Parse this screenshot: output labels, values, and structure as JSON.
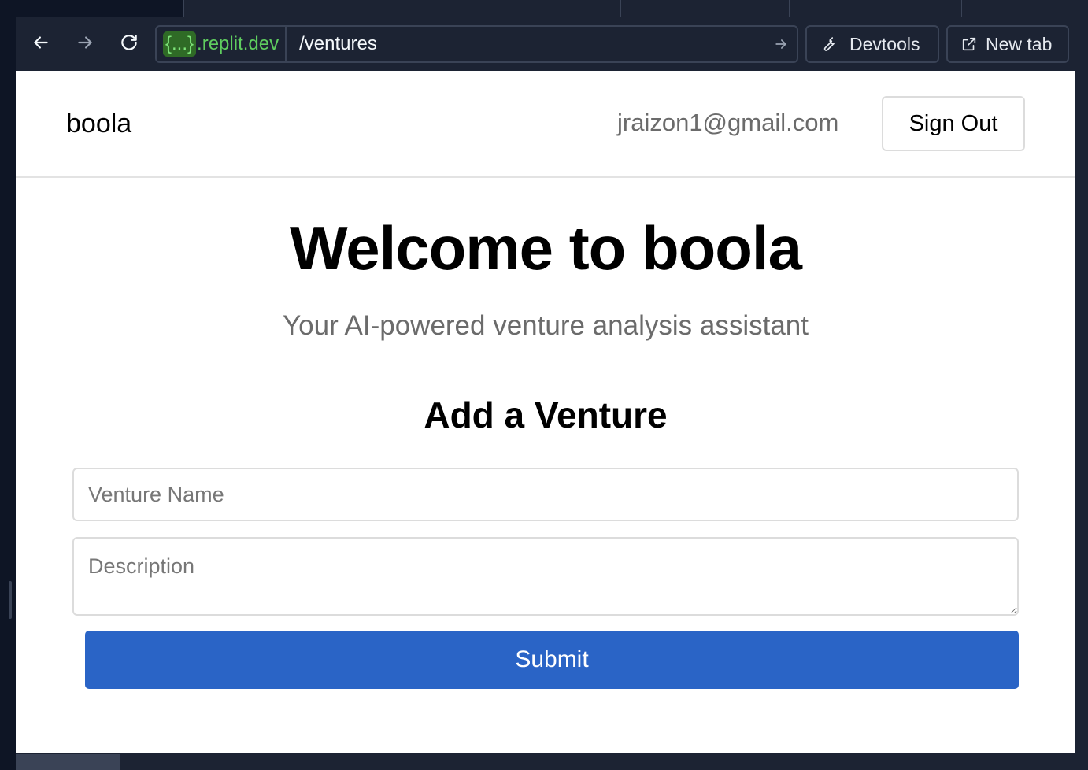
{
  "browser": {
    "url_host_brace": "{...}",
    "url_host_domain": ".replit.dev",
    "url_path": "/ventures",
    "devtools_label": "Devtools",
    "new_tab_label": "New tab",
    "icons": [
      "arrow-left-icon",
      "arrow-right-icon",
      "refresh-icon",
      "go-arrow-icon",
      "wrench-icon",
      "external-link-icon"
    ]
  },
  "header": {
    "brand": "boola",
    "user_email": "jraizon1@gmail.com",
    "sign_out_label": "Sign Out"
  },
  "hero": {
    "title": "Welcome to boola",
    "subtitle": "Your AI-powered venture analysis assistant"
  },
  "form": {
    "title": "Add a Venture",
    "name_placeholder": "Venture Name",
    "description_placeholder": "Description",
    "submit_label": "Submit"
  },
  "colors": {
    "chrome_bg": "#1c2333",
    "accent": "#2a64c6",
    "url_host": "#5fce5f"
  }
}
